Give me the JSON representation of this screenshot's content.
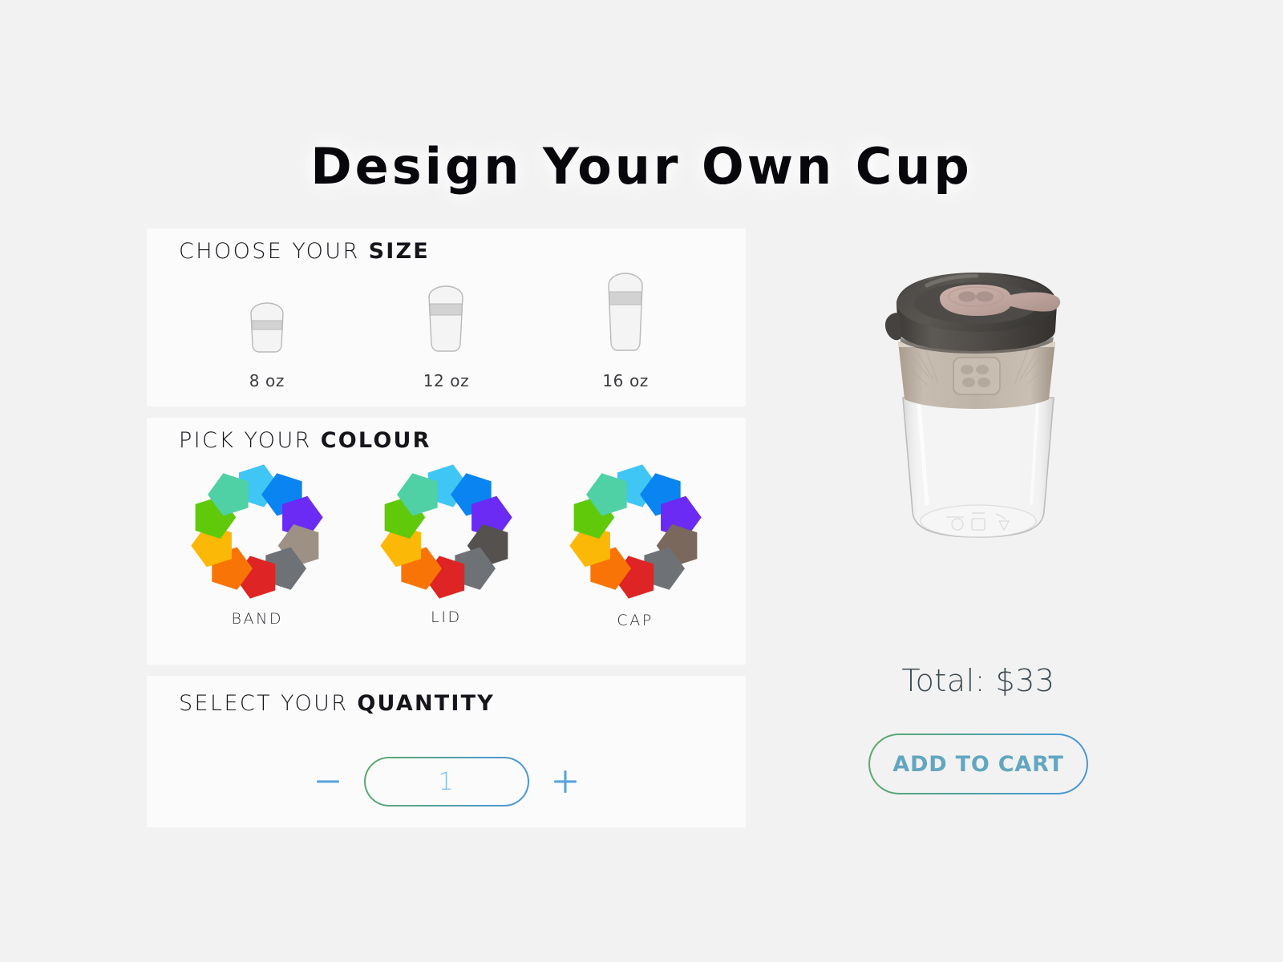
{
  "page": {
    "title": "Design Your Own Cup",
    "background_color": "#F2F2F2",
    "card_color": "#FBFBFB"
  },
  "size_section": {
    "heading_light": "CHOOSE YOUR ",
    "heading_bold": "SIZE",
    "options": [
      {
        "label": "8 oz",
        "value": "8",
        "icon": "cup-small-icon"
      },
      {
        "label": "12 oz",
        "value": "12",
        "icon": "cup-medium-icon"
      },
      {
        "label": "16 oz",
        "value": "16",
        "icon": "cup-large-icon"
      }
    ]
  },
  "colour_section": {
    "heading_light": "PICK YOUR ",
    "heading_bold": "COLOUR",
    "parts": [
      {
        "label": "BAND",
        "icon": "colour-wheel-icon",
        "swatches": [
          "#3FC6F5",
          "#0A84F0",
          "#6B2BF5",
          "#9C9184",
          "#6E7176",
          "#DE2424",
          "#F97406",
          "#FBB806",
          "#5FC90A",
          "#4FD1A5"
        ]
      },
      {
        "label": "LID",
        "icon": "colour-wheel-icon",
        "swatches": [
          "#3FC6F5",
          "#0A84F0",
          "#6B2BF5",
          "#55514E",
          "#6E7176",
          "#DE2424",
          "#F97406",
          "#FBB806",
          "#5FC90A",
          "#4FD1A5"
        ]
      },
      {
        "label": "CAP",
        "icon": "colour-wheel-icon",
        "swatches": [
          "#3FC6F5",
          "#0A84F0",
          "#6B2BF5",
          "#7A685C",
          "#6E7176",
          "#DE2424",
          "#F97406",
          "#FBB806",
          "#5FC90A",
          "#4FD1A5"
        ]
      }
    ]
  },
  "quantity_section": {
    "heading_light": "SELECT YOUR ",
    "heading_bold": "QUANTITY",
    "decrement_icon": "minus-icon",
    "increment_icon": "plus-icon",
    "value": "1",
    "value_color": "#7FBDEA"
  },
  "preview": {
    "product_image_name": "keepcup-glass-cup-image",
    "lid_color": "#4A4745",
    "cap_color": "#C4A9A2",
    "band_color": "#BDB2A6",
    "total_label": "Total: $33",
    "add_to_cart_label": "ADD TO CART",
    "accent_gradient_start": "#5EA96D",
    "accent_gradient_end": "#4B96D8",
    "button_text_color": "#63A6C0"
  }
}
